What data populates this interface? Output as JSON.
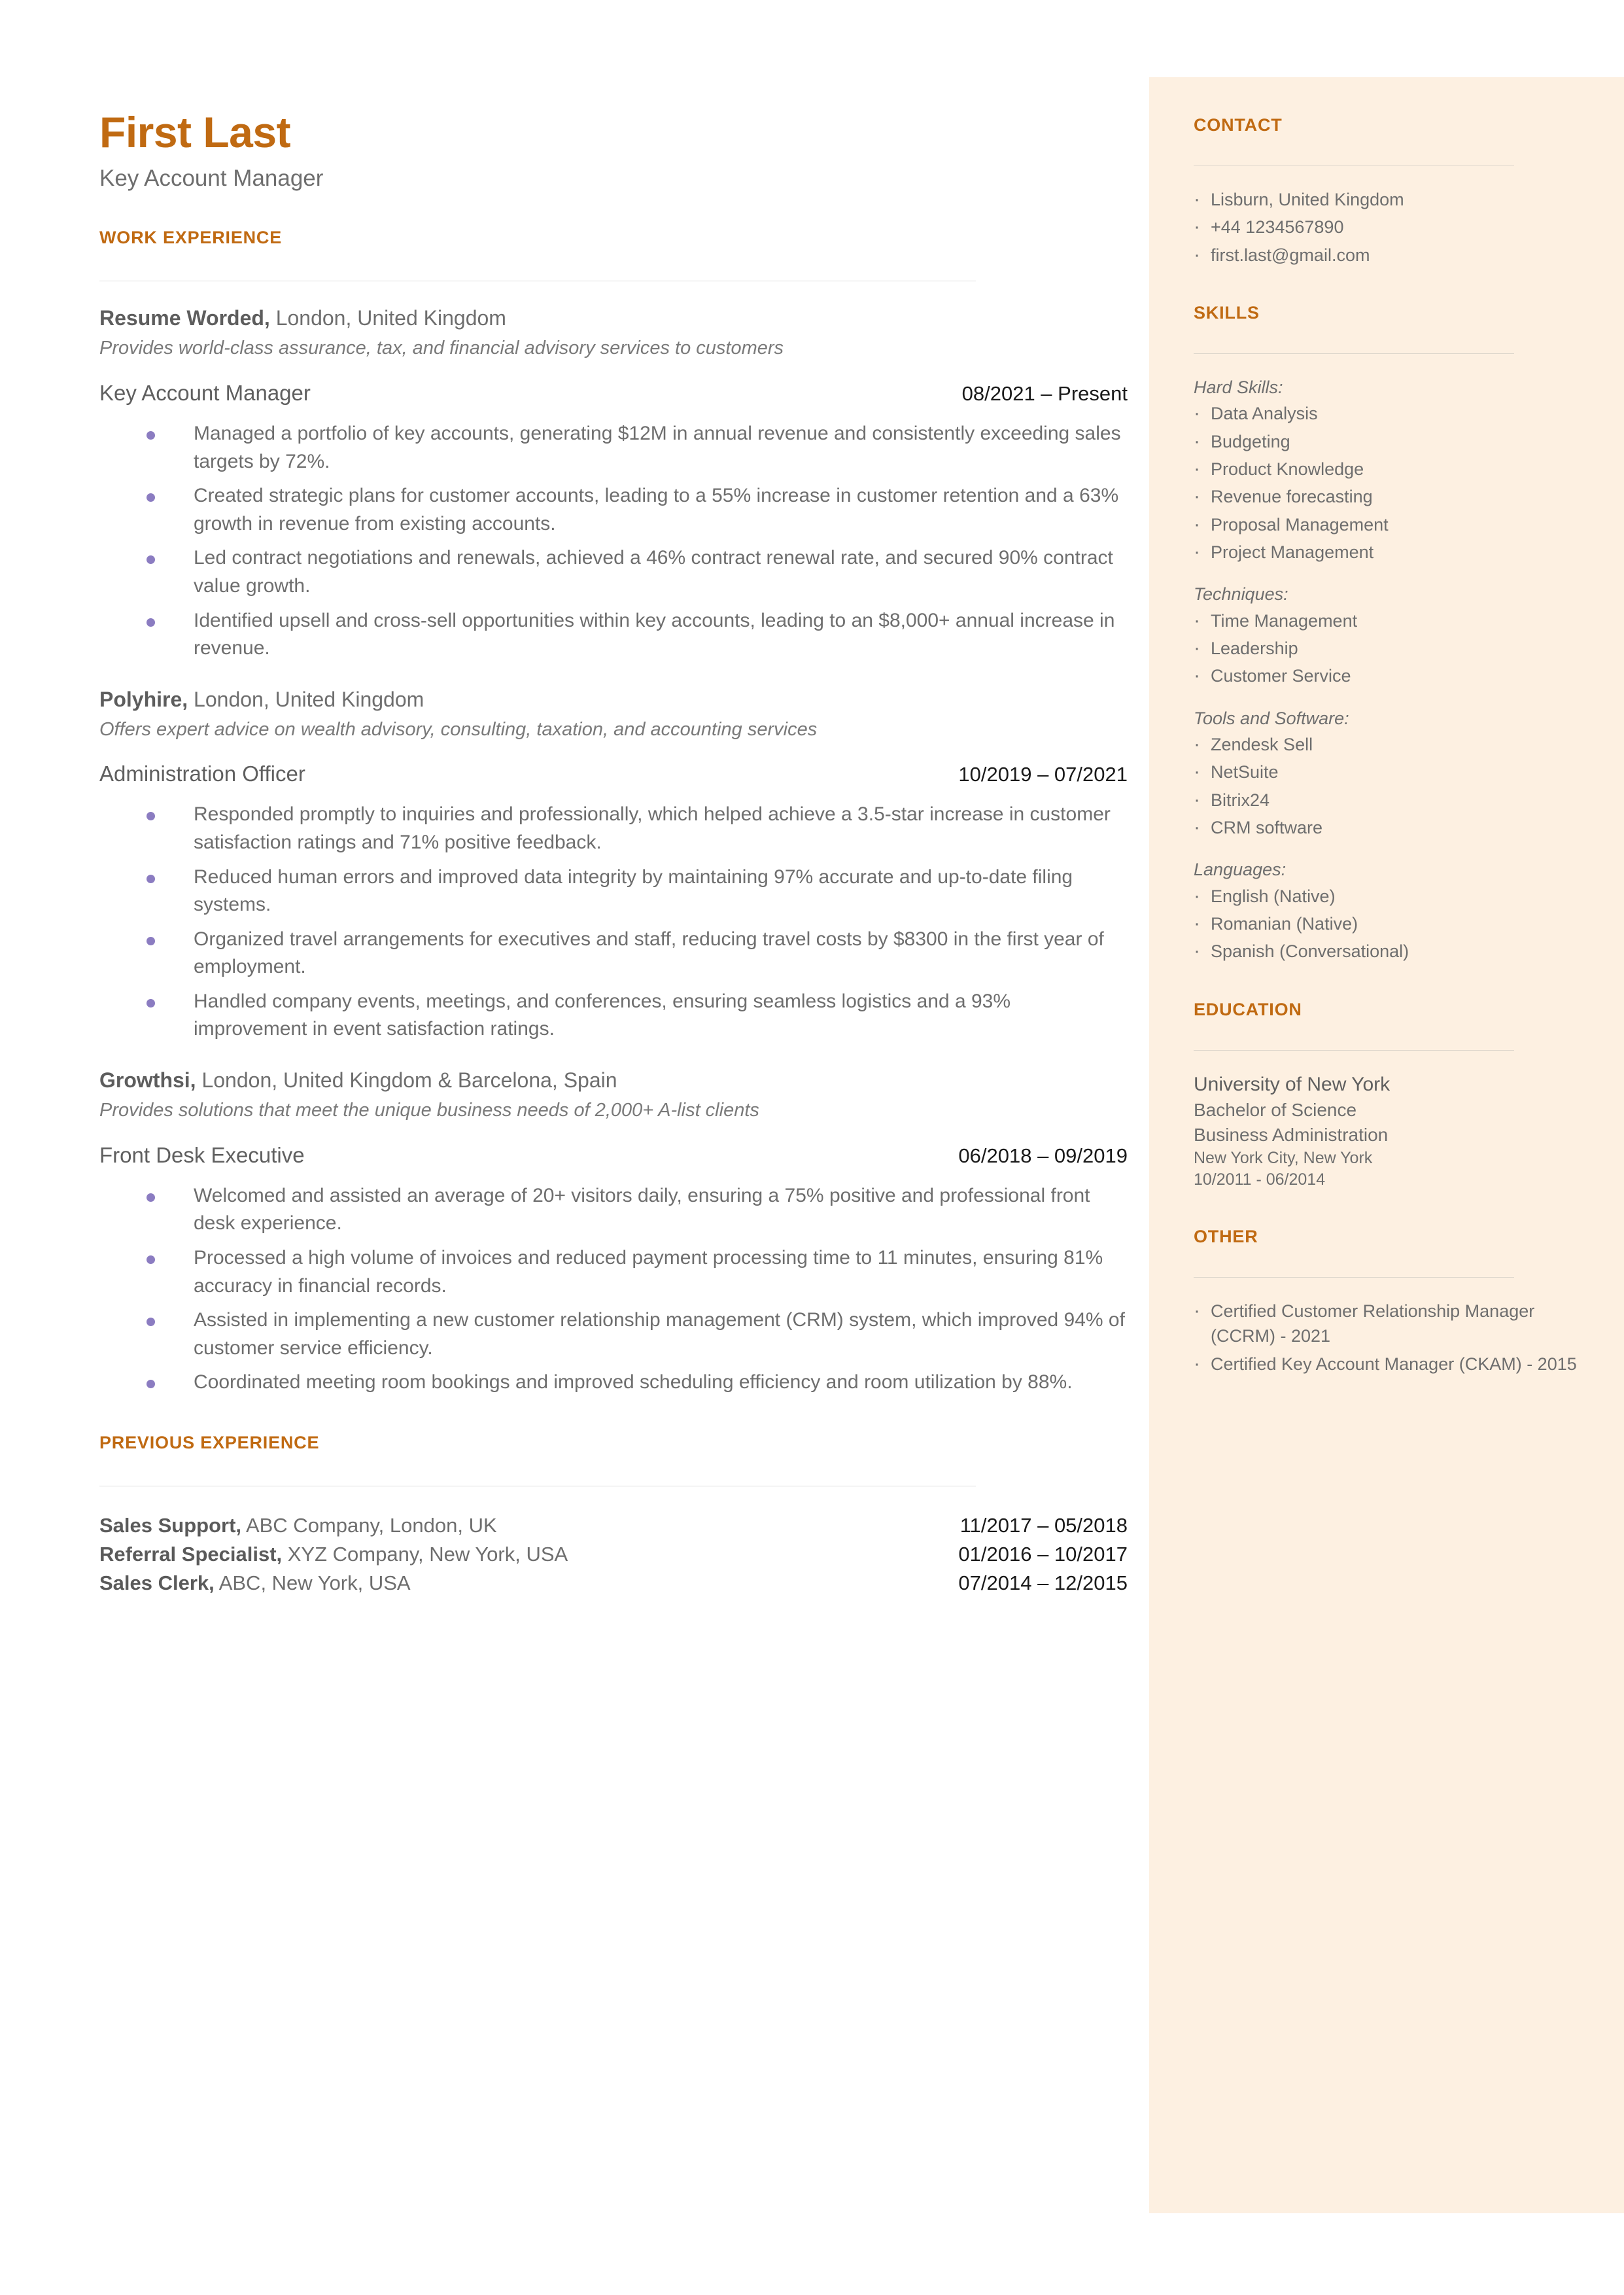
{
  "header": {
    "name": "First Last",
    "job_title": "Key Account Manager"
  },
  "colors": {
    "accent": "#c06a12",
    "sidebar_bg": "#fdf0e1",
    "bullet": "#8b7cc1",
    "body_text": "#6e6e6e"
  },
  "main": {
    "work_experience_heading": "WORK EXPERIENCE",
    "previous_experience_heading": "PREVIOUS EXPERIENCE",
    "jobs": [
      {
        "company": "Resume Worded,",
        "location": " London, United Kingdom",
        "description": "Provides world-class assurance, tax, and financial advisory services to customers",
        "role": "Key Account Manager",
        "dates": "08/2021 – Present",
        "bullets": [
          "Managed a portfolio of key accounts, generating $12M in annual revenue and consistently exceeding sales targets by 72%.",
          "Created strategic plans for customer accounts, leading to a 55% increase in customer retention and a 63% growth in revenue from existing accounts.",
          "Led contract negotiations and renewals, achieved a 46% contract renewal rate, and secured 90% contract value growth.",
          "Identified upsell and cross-sell opportunities within key accounts, leading to an $8,000+ annual increase in revenue."
        ]
      },
      {
        "company": "Polyhire,",
        "location": " London, United Kingdom",
        "description": "Offers expert advice on wealth advisory, consulting, taxation, and accounting services",
        "role": "Administration Officer",
        "dates": "10/2019 – 07/2021",
        "bullets": [
          "Responded promptly to inquiries and professionally, which helped achieve a 3.5-star increase in customer satisfaction ratings and 71% positive feedback.",
          "Reduced human errors and improved data integrity by maintaining 97% accurate and up-to-date filing systems.",
          "Organized travel arrangements for executives and staff, reducing travel costs by $8300 in the first year of employment.",
          "Handled company events, meetings, and conferences, ensuring seamless logistics and a 93% improvement in event satisfaction ratings."
        ]
      },
      {
        "company": "Growthsi,",
        "location": " London, United Kingdom & Barcelona, Spain",
        "description": "Provides solutions that meet the unique business needs of 2,000+ A-list clients",
        "role": "Front Desk Executive",
        "dates": "06/2018 – 09/2019",
        "bullets": [
          "Welcomed and assisted an average of 20+ visitors daily, ensuring a 75% positive and professional front desk experience.",
          "Processed a high volume of invoices and reduced payment processing time to 11 minutes, ensuring 81% accuracy in financial records.",
          "Assisted in implementing a new customer relationship management (CRM) system, which improved 94% of customer service efficiency.",
          "Coordinated meeting room bookings and improved scheduling efficiency and room utilization by 88%."
        ]
      }
    ],
    "previous_experience": [
      {
        "role": "Sales Support,",
        "detail": " ABC Company, London, UK",
        "dates": "11/2017 – 05/2018"
      },
      {
        "role": "Referral Specialist,",
        "detail": " XYZ Company, New York, USA",
        "dates": "01/2016 – 10/2017"
      },
      {
        "role": "Sales Clerk,",
        "detail": " ABC, New York, USA",
        "dates": "07/2014 – 12/2015"
      }
    ]
  },
  "sidebar": {
    "contact": {
      "heading": "CONTACT",
      "items": [
        "Lisburn, United Kingdom",
        "+44 1234567890",
        "first.last@gmail.com"
      ]
    },
    "skills": {
      "heading": "SKILLS",
      "groups": [
        {
          "label": "Hard Skills:",
          "items": [
            "Data Analysis",
            "Budgeting",
            "Product Knowledge",
            "Revenue forecasting",
            "Proposal Management",
            "Project Management"
          ]
        },
        {
          "label": "Techniques:",
          "items": [
            "Time Management",
            "Leadership",
            "Customer Service"
          ]
        },
        {
          "label": "Tools and Software:",
          "items": [
            "Zendesk Sell",
            "NetSuite",
            "Bitrix24",
            "CRM software"
          ]
        },
        {
          "label": "Languages:",
          "items": [
            "English (Native)",
            "Romanian (Native)",
            "Spanish (Conversational)"
          ]
        }
      ]
    },
    "education": {
      "heading": "EDUCATION",
      "school": "University of New York",
      "degree": "Bachelor of Science",
      "field": "Business Administration",
      "location": "New York City, New York",
      "dates": "10/2011 - 06/2014"
    },
    "other": {
      "heading": "OTHER",
      "items": [
        "Certified Customer Relationship Manager (CCRM) - 2021",
        "Certified Key Account Manager (CKAM) - 2015"
      ]
    }
  }
}
